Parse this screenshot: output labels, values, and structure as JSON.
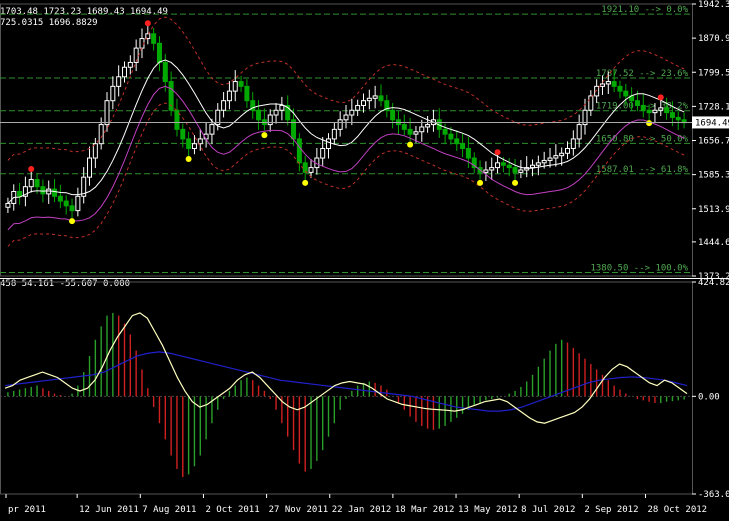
{
  "header": {
    "ohlc": "1703.48 1723.23 1689.43 1694.49",
    "bands": "725.0315 1696.8829",
    "indicator": "458 54.161 -55.607 0.000"
  },
  "colors": {
    "background": "#000000",
    "grid": "#2f2f2f",
    "bull": "#ffffff",
    "bear": "#00aa00",
    "fib": "#2f8f2f",
    "band_outer": "#c0302a",
    "band_mid": "#ffffff",
    "lower_ma": "#c040c0",
    "fractal_up": "#ff2020",
    "fractal_down": "#ffff00",
    "hist_pos": "#2aa02a",
    "hist_neg": "#d02020",
    "osc_signal": "#2020cc",
    "osc_line": "#ffffc0"
  },
  "chart_data": {
    "type": "candlestick",
    "price_axis": {
      "ylim": [
        1373.2,
        1942.3
      ],
      "ticks": [
        "1942.30",
        "1870.90",
        "1799.50",
        "1728.10",
        "1656.70",
        "1585.30",
        "1513.90",
        "1444.60",
        "1373.20"
      ],
      "current_price": "1694.49"
    },
    "x_ticks": [
      "pr 2011",
      "12 Jun 2011",
      "7 Aug 2011",
      "2 Oct 2011",
      "27 Nov 2011",
      "22 Jan 2012",
      "18 Mar 2012",
      "13 May 2012",
      "8 Jul 2012",
      "2 Sep 2012",
      "28 Oct 2012"
    ],
    "fibonacci": [
      {
        "price": 1921.1,
        "label": "1921.10 --> 0.0%"
      },
      {
        "price": 1787.52,
        "label": "1787.52 --> 23.6%"
      },
      {
        "price": 1719.0,
        "label": "1719.00 --> 38.2%"
      },
      {
        "price": 1650.8,
        "label": "1650.80 --> 50.0%"
      },
      {
        "price": 1587.01,
        "label": "1587.01 --> 61.8%"
      },
      {
        "price": 1380.5,
        "label": "1380.50 --> 100.0%"
      }
    ],
    "close": [
      1525,
      1550,
      1540,
      1560,
      1575,
      1560,
      1545,
      1555,
      1540,
      1530,
      1520,
      1510,
      1540,
      1580,
      1620,
      1650,
      1690,
      1740,
      1770,
      1790,
      1810,
      1820,
      1850,
      1870,
      1880,
      1860,
      1820,
      1780,
      1720,
      1680,
      1660,
      1640,
      1650,
      1660,
      1670,
      1690,
      1720,
      1740,
      1760,
      1780,
      1770,
      1740,
      1720,
      1700,
      1690,
      1710,
      1720,
      1730,
      1700,
      1660,
      1610,
      1590,
      1600,
      1620,
      1640,
      1660,
      1680,
      1700,
      1710,
      1720,
      1730,
      1740,
      1745,
      1750,
      1740,
      1720,
      1700,
      1690,
      1680,
      1670,
      1675,
      1685,
      1690,
      1700,
      1680,
      1670,
      1660,
      1650,
      1640,
      1620,
      1600,
      1590,
      1595,
      1600,
      1610,
      1605,
      1600,
      1590,
      1595,
      1600,
      1605,
      1610,
      1615,
      1620,
      1625,
      1630,
      1640,
      1660,
      1690,
      1720,
      1750,
      1770,
      1775,
      1780,
      1770,
      1760,
      1750,
      1740,
      1730,
      1720,
      1715,
      1720,
      1725,
      1715,
      1705,
      1700,
      1694
    ],
    "indicator_axis": {
      "ylim": [
        -363.019,
        424.825
      ],
      "ticks": [
        "424.825",
        "0.00",
        "-363.019"
      ]
    },
    "histogram": [
      15,
      20,
      25,
      30,
      35,
      40,
      30,
      20,
      10,
      5,
      0,
      10,
      40,
      90,
      150,
      210,
      260,
      300,
      310,
      300,
      270,
      230,
      170,
      100,
      30,
      -40,
      -100,
      -160,
      -220,
      -270,
      -300,
      -290,
      -260,
      -220,
      -160,
      -100,
      -50,
      -10,
      20,
      40,
      60,
      70,
      60,
      40,
      20,
      -10,
      -50,
      -100,
      -150,
      -200,
      -250,
      -280,
      -270,
      -240,
      -200,
      -150,
      -100,
      -50,
      -10,
      20,
      40,
      50,
      55,
      50,
      40,
      25,
      0,
      -25,
      -50,
      -75,
      -95,
      -110,
      -120,
      -125,
      -120,
      -110,
      -95,
      -80,
      -65,
      -50,
      -35,
      -25,
      -15,
      -10,
      -5,
      0,
      10,
      20,
      35,
      55,
      80,
      110,
      140,
      170,
      195,
      210,
      200,
      180,
      160,
      140,
      120,
      100,
      80,
      60,
      40,
      25,
      10,
      0,
      -10,
      -15,
      -20,
      -25,
      -25,
      -20,
      -18,
      -15,
      -12
    ],
    "oscillator": [
      30,
      40,
      60,
      70,
      80,
      90,
      80,
      70,
      50,
      30,
      20,
      30,
      60,
      110,
      170,
      220,
      260,
      300,
      310,
      290,
      240,
      190,
      130,
      70,
      20,
      -20,
      -40,
      -30,
      -10,
      10,
      30,
      60,
      80,
      90,
      70,
      40,
      10,
      -20,
      -40,
      -50,
      -40,
      -20,
      0,
      20,
      40,
      50,
      55,
      50,
      45,
      30,
      10,
      -10,
      -20,
      -30,
      -35,
      -40,
      -45,
      -48,
      -50,
      -52,
      -55,
      -50,
      -40,
      -30,
      -20,
      -15,
      -10,
      -20,
      -40,
      -60,
      -80,
      -95,
      -100,
      -90,
      -80,
      -70,
      -60,
      -40,
      -10,
      30,
      70,
      100,
      120,
      110,
      90,
      70,
      50,
      40,
      60,
      50,
      30,
      10
    ],
    "signal": [
      40,
      45,
      50,
      55,
      60,
      65,
      70,
      75,
      80,
      90,
      110,
      130,
      150,
      160,
      165,
      160,
      150,
      140,
      130,
      120,
      110,
      100,
      90,
      80,
      70,
      60,
      55,
      50,
      45,
      40,
      35,
      30,
      25,
      20,
      15,
      10,
      5,
      0,
      -10,
      -20,
      -30,
      -40,
      -45,
      -50,
      -55,
      -55,
      -50,
      -40,
      -25,
      -10,
      5,
      20,
      35,
      50,
      60,
      65,
      70,
      72,
      70,
      65,
      60,
      50,
      40
    ]
  }
}
